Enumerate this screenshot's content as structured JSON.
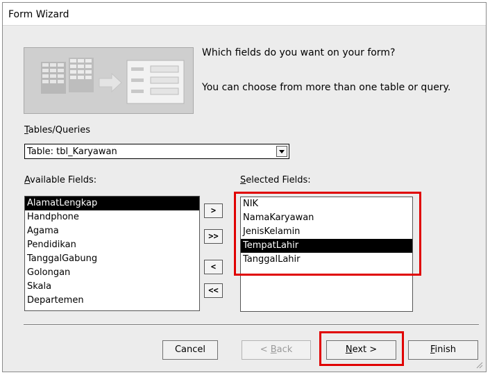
{
  "window": {
    "title": "Form Wizard"
  },
  "intro": {
    "question": "Which fields do you want on your form?",
    "hint": "You can choose from more than one table or query."
  },
  "tables_queries": {
    "label_prefix": "",
    "label_hotkey": "T",
    "label_rest": "ables/Queries",
    "selected": "Table: tbl_Karyawan"
  },
  "available": {
    "label_hotkey": "A",
    "label_rest": "vailable Fields:",
    "items": [
      "AlamatLengkap",
      "Handphone",
      "Agama",
      "Pendidikan",
      "TanggalGabung",
      "Golongan",
      "Skala",
      "Departemen"
    ]
  },
  "selected_fields": {
    "label_hotkey": "S",
    "label_rest": "elected Fields:",
    "items": [
      "NIK",
      "NamaKaryawan",
      "JenisKelamin",
      "TempatLahir",
      "TanggalLahir"
    ]
  },
  "move_buttons": {
    "add_one": ">",
    "add_all": ">>",
    "remove_one": "<",
    "remove_all": "<<"
  },
  "buttons": {
    "cancel": "Cancel",
    "back_prefix": "< ",
    "back_hotkey": "B",
    "back_rest": "ack",
    "next_hotkey": "N",
    "next_rest": "ext >",
    "finish_hotkey": "F",
    "finish_rest": "inish"
  },
  "colors": {
    "highlight": "#e00000",
    "selection": "#000000"
  }
}
